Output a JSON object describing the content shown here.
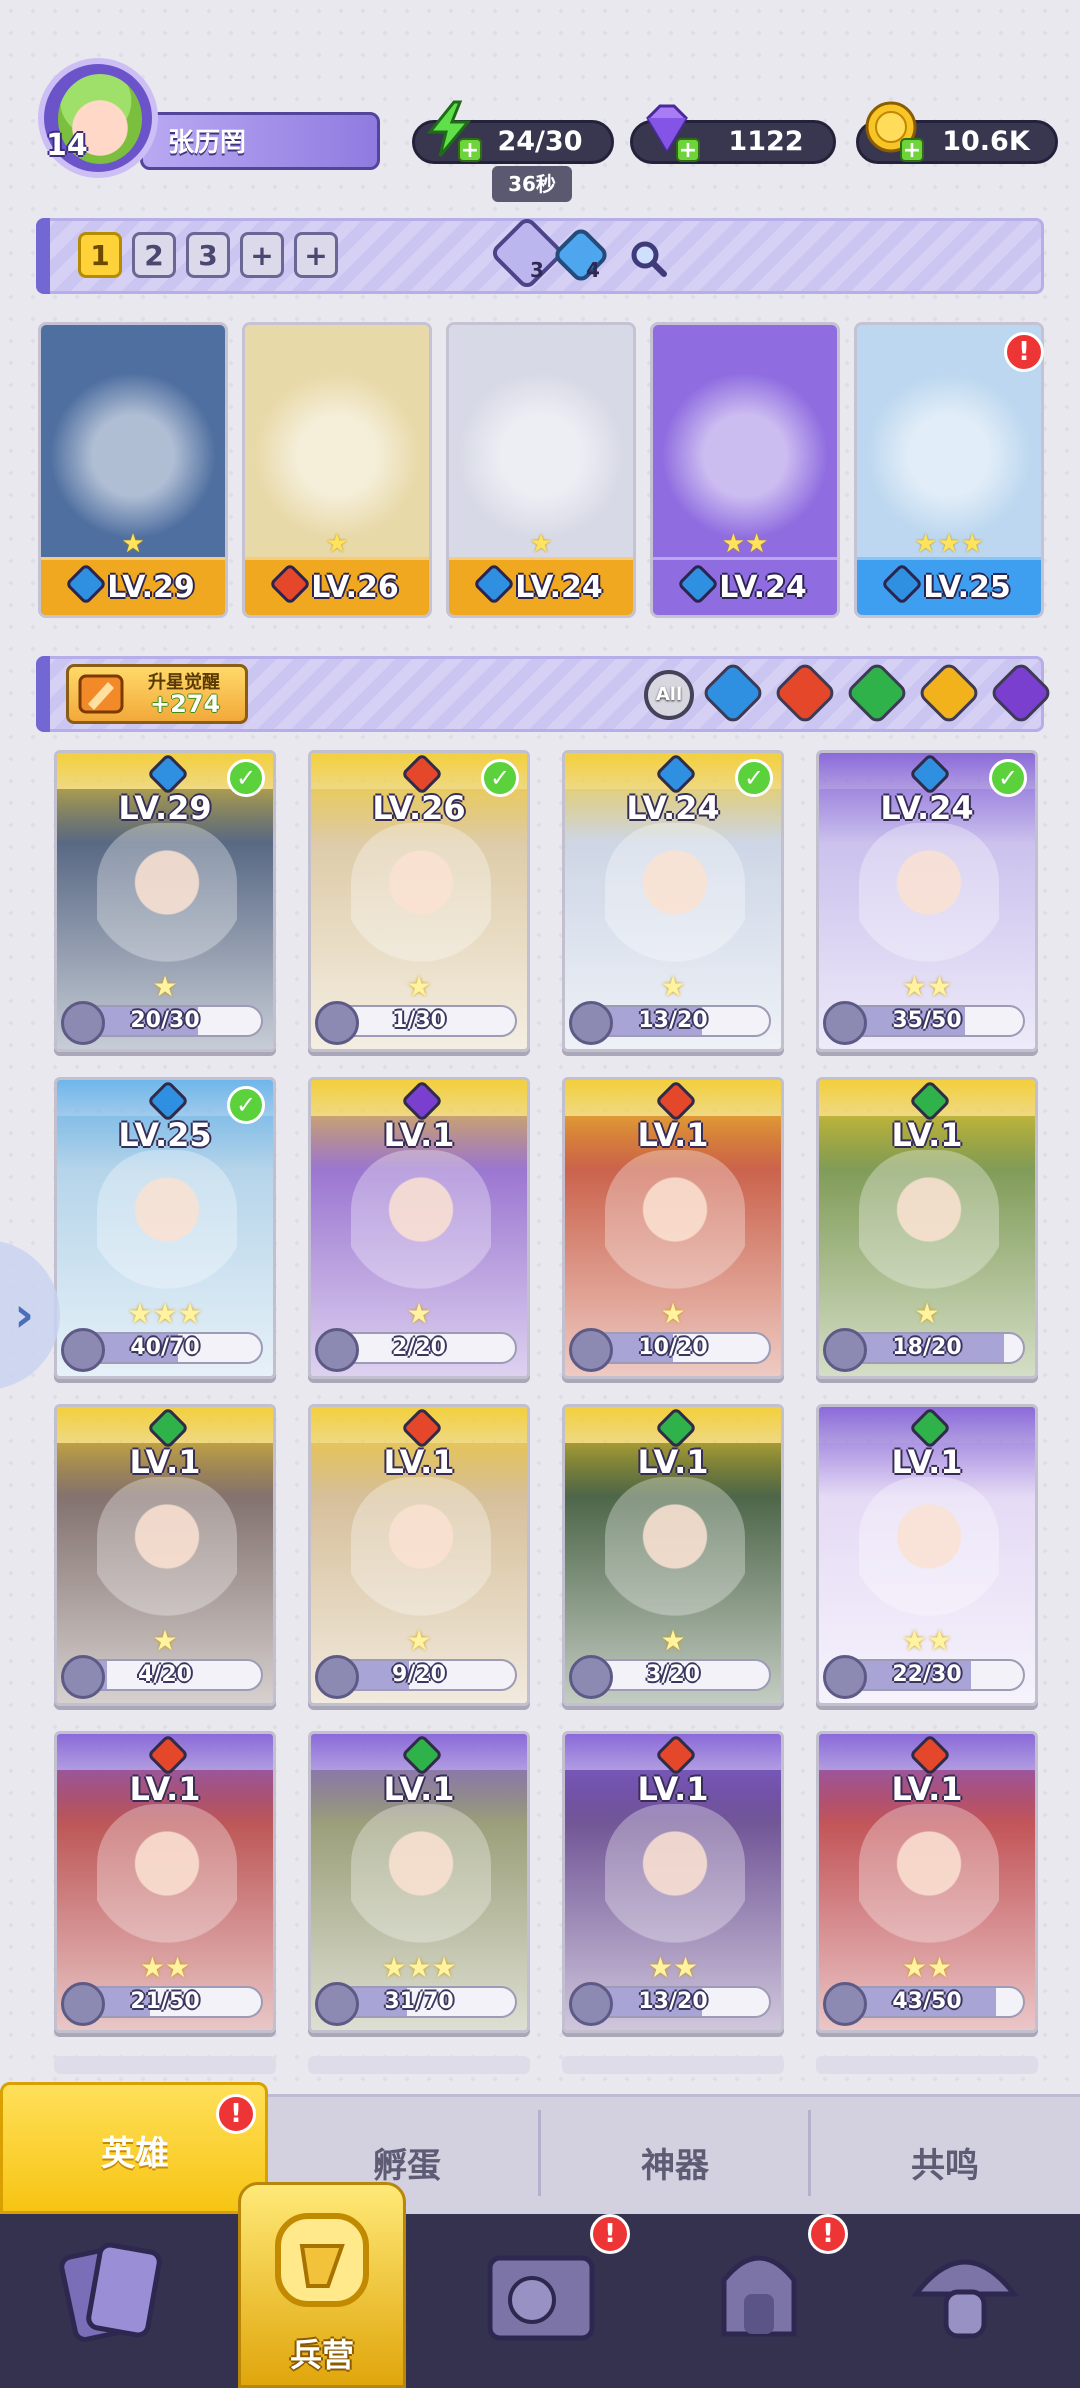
{
  "player": {
    "name": "张历罔",
    "level": "14"
  },
  "resources": {
    "energy": {
      "value": "24/30",
      "timer": "36秒",
      "icon": "lightning-icon"
    },
    "gems": {
      "value": "1122",
      "icon": "purple-gem-icon"
    },
    "coins": {
      "value": "10.6K",
      "icon": "coin-icon"
    }
  },
  "team_slots": [
    "1",
    "2",
    "3",
    "+",
    "+"
  ],
  "team_gems": {
    "left": "3",
    "right": "4"
  },
  "team": [
    {
      "level": "LV.29",
      "stars": "★",
      "element": "water",
      "bg": "#4f6fa0",
      "foot": "#f0a820"
    },
    {
      "level": "LV.26",
      "stars": "★",
      "element": "fire",
      "bg": "#e8d9a8",
      "foot": "#f0a820"
    },
    {
      "level": "LV.24",
      "stars": "★",
      "element": "water",
      "bg": "#d7d9e6",
      "foot": "#f0a820"
    },
    {
      "level": "LV.24",
      "stars": "★★",
      "element": "water",
      "bg": "#8f6de0",
      "foot": "#8f6de0"
    },
    {
      "level": "LV.25",
      "stars": "★★★",
      "element": "water",
      "bg": "#bcd7ef",
      "foot": "#3e9ef0",
      "alert": "!"
    }
  ],
  "upgrade": {
    "title": "升星觉醒",
    "value": "+274"
  },
  "filters": [
    "All",
    "water",
    "fire",
    "nature",
    "light",
    "dark"
  ],
  "element_colors": {
    "water": "#2f8fe0",
    "fire": "#e5472a",
    "nature": "#2fb24a",
    "light": "#f2b21b",
    "dark": "#7b3fd0"
  },
  "heroes": [
    {
      "level": "LV.29",
      "element": "water",
      "progress": "20/30",
      "fill": 0.67,
      "stars": "★",
      "top": "#f3cf3c",
      "bg": "#3c4f6f",
      "check": true
    },
    {
      "level": "LV.26",
      "element": "fire",
      "progress": "1/30",
      "fill": 0.03,
      "stars": "★",
      "top": "#f3cf3c",
      "bg": "#d8c39a",
      "check": true
    },
    {
      "level": "LV.24",
      "element": "water",
      "progress": "13/20",
      "fill": 0.65,
      "stars": "★",
      "top": "#f3cf3c",
      "bg": "#c5cfe2",
      "check": true
    },
    {
      "level": "LV.24",
      "element": "water",
      "progress": "35/50",
      "fill": 0.7,
      "stars": "★★",
      "top": "#8b6ad9",
      "bg": "#c2b7ea",
      "check": true
    },
    {
      "level": "LV.25",
      "element": "water",
      "progress": "40/70",
      "fill": 0.57,
      "stars": "★★★",
      "top": "#6fb6ea",
      "bg": "#a9cde6",
      "check": true
    },
    {
      "level": "LV.1",
      "element": "dark",
      "progress": "2/20",
      "fill": 0.1,
      "stars": "★",
      "top": "#f3cf3c",
      "bg": "#8a5fc9"
    },
    {
      "level": "LV.1",
      "element": "fire",
      "progress": "10/20",
      "fill": 0.5,
      "stars": "★",
      "top": "#f3cf3c",
      "bg": "#c2482e"
    },
    {
      "level": "LV.1",
      "element": "nature",
      "progress": "18/20",
      "fill": 0.9,
      "stars": "★",
      "top": "#f3cf3c",
      "bg": "#6b8b3c"
    },
    {
      "level": "LV.1",
      "element": "nature",
      "progress": "4/20",
      "fill": 0.2,
      "stars": "★",
      "top": "#f3cf3c",
      "bg": "#6e5a56"
    },
    {
      "level": "LV.1",
      "element": "fire",
      "progress": "9/20",
      "fill": 0.45,
      "stars": "★",
      "top": "#f3cf3c",
      "bg": "#cfb58a"
    },
    {
      "level": "LV.1",
      "element": "nature",
      "progress": "3/20",
      "fill": 0.15,
      "stars": "★",
      "top": "#f3cf3c",
      "bg": "#2f4c2a"
    },
    {
      "level": "LV.1",
      "element": "nature",
      "progress": "22/30",
      "fill": 0.73,
      "stars": "★★",
      "top": "#8b6ad9",
      "bg": "#e0d4f3"
    },
    {
      "level": "LV.1",
      "element": "fire",
      "progress": "21/50",
      "fill": 0.42,
      "stars": "★★",
      "top": "#8b6ad9",
      "bg": "#b23a3a"
    },
    {
      "level": "LV.1",
      "element": "nature",
      "progress": "31/70",
      "fill": 0.44,
      "stars": "★★★",
      "top": "#8b6ad9",
      "bg": "#8a8f63"
    },
    {
      "level": "LV.1",
      "element": "fire",
      "progress": "13/20",
      "fill": 0.65,
      "stars": "★★",
      "top": "#8b6ad9",
      "bg": "#5a3a85"
    },
    {
      "level": "LV.1",
      "element": "fire",
      "progress": "43/50",
      "fill": 0.86,
      "stars": "★★",
      "top": "#8b6ad9",
      "bg": "#b8383c"
    }
  ],
  "tabs": [
    {
      "label": "英雄",
      "active": true,
      "badge": "!"
    },
    {
      "label": "孵蛋"
    },
    {
      "label": "神器"
    },
    {
      "label": "共鸣"
    }
  ],
  "nav": [
    {
      "icon": "cards-icon"
    },
    {
      "icon": "barracks-icon",
      "label": "兵营",
      "active": true
    },
    {
      "icon": "map-book-icon",
      "badge": "!"
    },
    {
      "icon": "temple-icon",
      "badge": "!"
    },
    {
      "icon": "mushroom-icon"
    }
  ]
}
